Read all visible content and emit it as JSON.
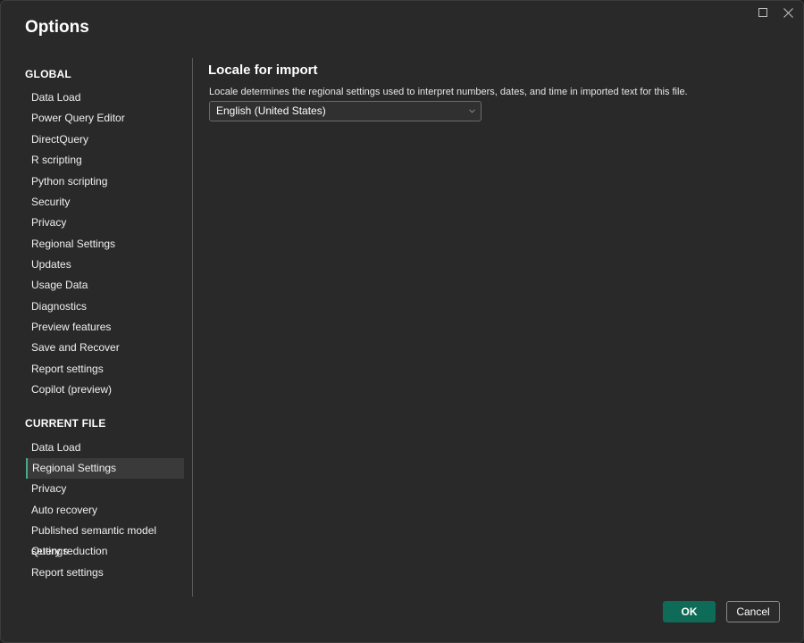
{
  "dialog": {
    "title": "Options"
  },
  "sidebar": {
    "global_heading": "GLOBAL",
    "global_items": [
      {
        "label": "Data Load"
      },
      {
        "label": "Power Query Editor"
      },
      {
        "label": "DirectQuery"
      },
      {
        "label": "R scripting"
      },
      {
        "label": "Python scripting"
      },
      {
        "label": "Security"
      },
      {
        "label": "Privacy"
      },
      {
        "label": "Regional Settings"
      },
      {
        "label": "Updates"
      },
      {
        "label": "Usage Data"
      },
      {
        "label": "Diagnostics"
      },
      {
        "label": "Preview features"
      },
      {
        "label": "Save and Recover"
      },
      {
        "label": "Report settings"
      },
      {
        "label": "Copilot (preview)"
      }
    ],
    "current_heading": "CURRENT FILE",
    "current_items": [
      {
        "label": "Data Load"
      },
      {
        "label": "Regional Settings",
        "selected": true
      },
      {
        "label": "Privacy"
      },
      {
        "label": "Auto recovery"
      },
      {
        "label": "Published semantic model settings"
      },
      {
        "label": "Query reduction"
      },
      {
        "label": "Report settings"
      }
    ]
  },
  "content": {
    "title": "Locale for import",
    "description": "Locale determines the regional settings used to interpret numbers, dates, and time in imported text for this file.",
    "locale_select": {
      "value": "English (United States)"
    }
  },
  "footer": {
    "ok_label": "OK",
    "cancel_label": "Cancel"
  },
  "colors": {
    "background": "#292929",
    "accent": "#0e6b58",
    "selection_bar": "#4aa98c"
  },
  "icons": {
    "maximize": "maximize-icon",
    "close": "close-icon",
    "dropdown": "chevron-down-icon"
  }
}
